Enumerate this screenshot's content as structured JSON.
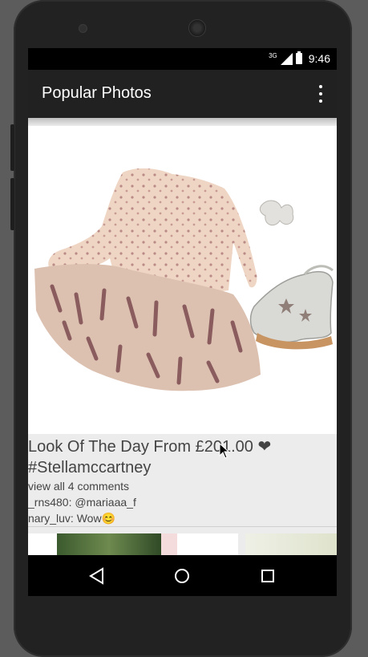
{
  "status_bar": {
    "network": "3G",
    "time": "9:46"
  },
  "app_bar": {
    "title": "Popular Photos"
  },
  "post": {
    "caption": "Look Of The Day From £201.00 ❤ #Stellamccartney",
    "comments_link": "view all 4 comments",
    "comments": [
      {
        "text": "_rns480: @mariaaa_f"
      },
      {
        "text": "nary_luv: Wow😊"
      }
    ]
  },
  "colors": {
    "app_bar": "#212121",
    "content_bg": "#ececec",
    "caption_text": "#444444"
  },
  "icons": {
    "overflow": "more-vert-icon",
    "back": "back-triangle-icon",
    "home": "home-circle-icon",
    "recents": "recents-square-icon"
  }
}
